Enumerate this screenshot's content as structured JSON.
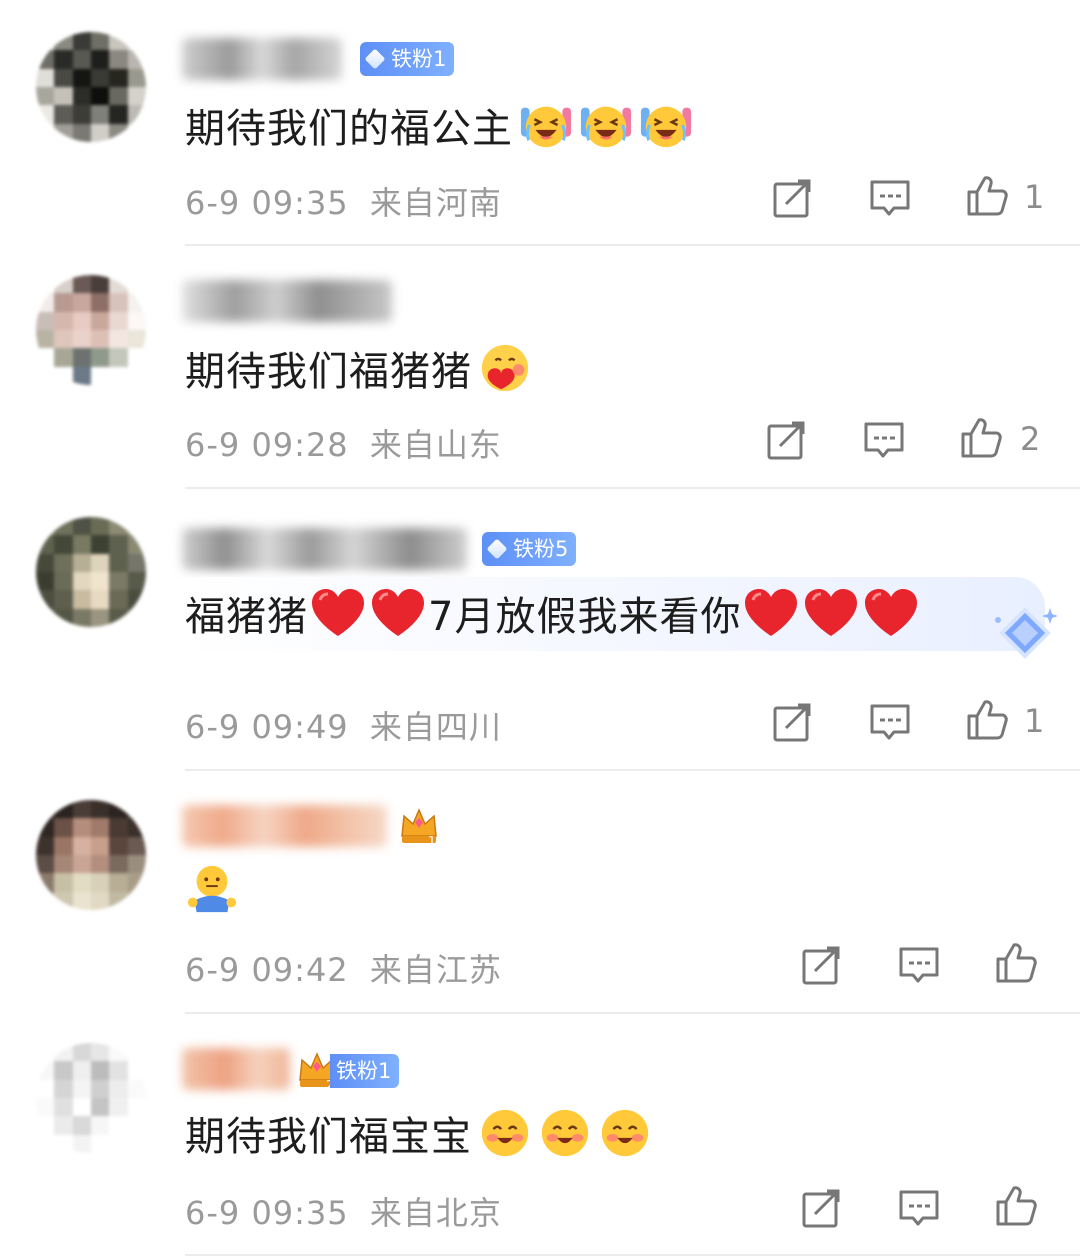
{
  "comments": [
    {
      "badge": "铁粉1",
      "text": "期待我们的福公主",
      "time": "6-9 09:35",
      "location": "来自河南",
      "likes": "1",
      "emoji": [
        "laughing-cry",
        "laughing-cry",
        "laughing-cry"
      ]
    },
    {
      "badge": "",
      "text": "期待我们福猪猪",
      "time": "6-9 09:28",
      "location": "来自山东",
      "likes": "2",
      "emoji": [
        "hug-heart"
      ]
    },
    {
      "badge": "铁粉5",
      "text_before": "福猪猪",
      "text_mid": "7月放假我来看你",
      "time": "6-9 09:49",
      "location": "来自四川",
      "likes": "1",
      "emoji": [
        "heart",
        "heart",
        "heart",
        "heart",
        "heart"
      ]
    },
    {
      "badge": "",
      "crown_level": "1",
      "text": "",
      "time": "6-9 09:42",
      "location": "来自江苏",
      "likes": "",
      "emoji": [
        "hug-person"
      ]
    },
    {
      "badge": "铁粉1",
      "crown_level": "2",
      "text": "期待我们福宝宝",
      "time": "6-9 09:35",
      "location": "来自北京",
      "likes": "",
      "emoji": [
        "blush-smile",
        "blush-smile",
        "blush-smile"
      ]
    }
  ],
  "icons": {
    "share": "share-icon",
    "reply": "comment-icon",
    "like": "thumbs-up-icon"
  },
  "colors": {
    "badge": "#5d8ff6",
    "meta_text": "#9a9a9a",
    "heart": "#e8242d",
    "emoji_yellow": "#ffc93a"
  }
}
